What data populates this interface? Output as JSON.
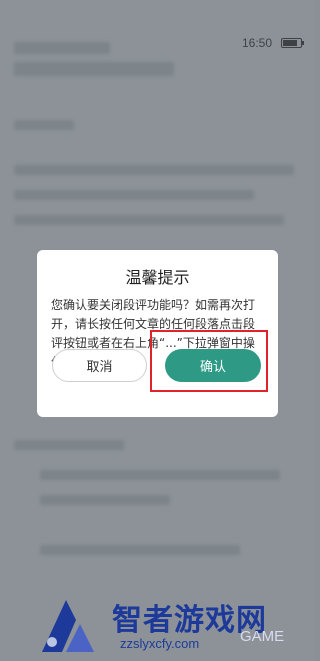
{
  "status_bar": {
    "time": "16:50",
    "battery_level": 0.8
  },
  "dialog": {
    "title": "温馨提示",
    "message": "您确认要关闭段评功能吗？如需再次打开，请长按任何文章的任何段落点击段评按钮或者在右上角“...”下拉弹窗中操作。",
    "cancel_label": "取消",
    "confirm_label": "确认"
  },
  "watermark": {
    "title": "智者游戏网",
    "url": "zzslyxcfy.com",
    "game": "GAME"
  },
  "colors": {
    "accent": "#2e9a86",
    "highlight": "#e0232a",
    "overlay": "#8c9298"
  }
}
